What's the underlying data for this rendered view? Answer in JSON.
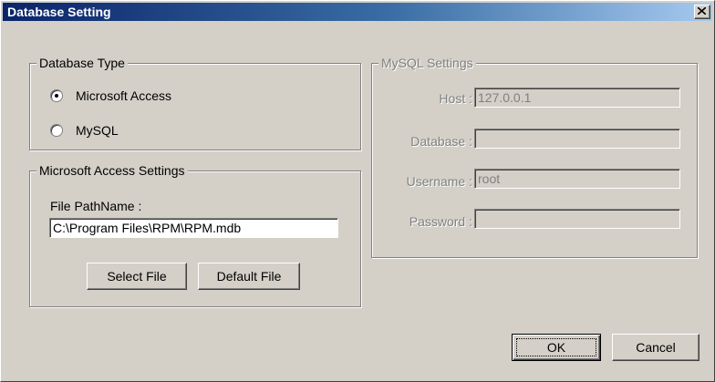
{
  "window": {
    "title": "Database Setting",
    "close_glyph": "×"
  },
  "database_type": {
    "legend": "Database Type",
    "options": [
      {
        "label": "Microsoft Access",
        "selected": true
      },
      {
        "label": "MySQL",
        "selected": false
      }
    ]
  },
  "access_settings": {
    "legend": "Microsoft Access Settings",
    "file_path_label": "File PathName :",
    "file_path_value": "C:\\Program Files\\RPM\\RPM.mdb",
    "select_file_label": "Select File",
    "default_file_label": "Default File"
  },
  "mysql_settings": {
    "legend": "MySQL Settings",
    "enabled": false,
    "host_label": "Host :",
    "host_value": "127.0.0.1",
    "database_label": "Database :",
    "database_value": "",
    "username_label": "Username :",
    "username_value": "root",
    "password_label": "Password :",
    "password_value": ""
  },
  "footer": {
    "ok_label": "OK",
    "cancel_label": "Cancel"
  },
  "colors": {
    "title_gradient_start": "#0a246a",
    "title_gradient_end": "#a6caf0",
    "dialog_face": "#d4d0c8",
    "disabled_text": "#808080"
  }
}
